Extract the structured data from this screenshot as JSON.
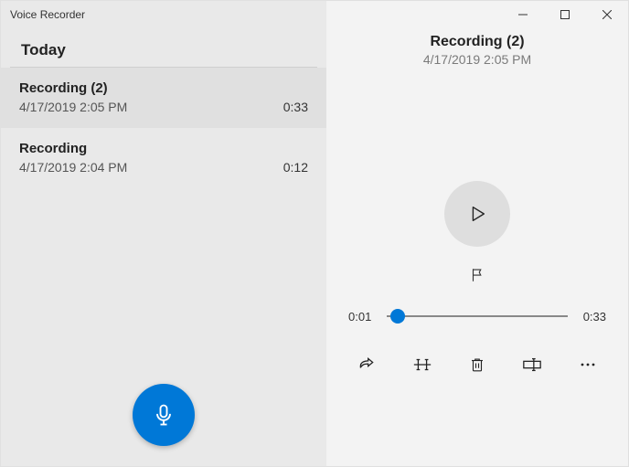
{
  "app_title": "Voice Recorder",
  "section_header": "Today",
  "recordings": [
    {
      "title": "Recording (2)",
      "date": "4/17/2019 2:05 PM",
      "duration": "0:33",
      "selected": true
    },
    {
      "title": "Recording",
      "date": "4/17/2019 2:04 PM",
      "duration": "0:12",
      "selected": false
    }
  ],
  "detail": {
    "title": "Recording (2)",
    "date": "4/17/2019 2:05 PM",
    "current_time": "0:01",
    "total_time": "0:33",
    "progress_percent": 6
  },
  "colors": {
    "accent": "#0078d7"
  }
}
